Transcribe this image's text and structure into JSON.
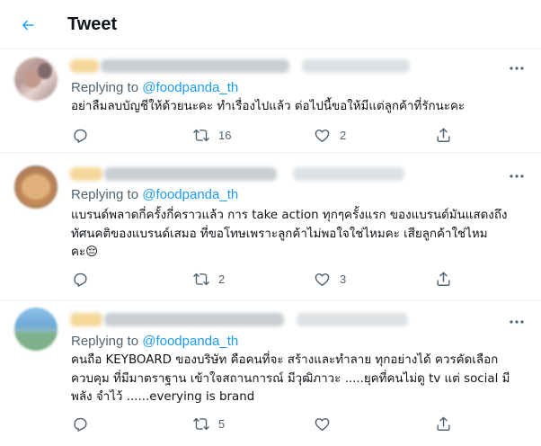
{
  "header": {
    "title": "Tweet",
    "back_icon": "arrow-left-icon",
    "accent_color": "#1d9bf0"
  },
  "tweets": [
    {
      "replying_prefix": "Replying to ",
      "replying_handle": "@foodpanda_th",
      "text": "อย่าลืมลบบัญชีให้ด้วยนะคะ ทำเรื่องไปแล้ว ต่อไปนี้ขอให้มีแต่ลูกค้าที่รักนะคะ",
      "reply_count": "",
      "retweet_count": "16",
      "like_count": "2"
    },
    {
      "replying_prefix": "Replying to ",
      "replying_handle": "@foodpanda_th",
      "text": "แบรนด์พลาดกี่ครั้งกี่คราวแล้ว การ take action ทุกๆครั้งแรก ของแบรนด์มันแสดงถึง\nทัศนคติของแบรนด์เสมอ ที่ขอโทษเพราะลูกค้าไม่พอใจใช่ไหมคะ เสียลูกค้าใช่ไหม\nคะ😔",
      "reply_count": "",
      "retweet_count": "2",
      "like_count": "3"
    },
    {
      "replying_prefix": "Replying to ",
      "replying_handle": "@foodpanda_th",
      "text": "คนถือ KEYBOARD ของบริษัท คือคนที่จะ สร้างและทำลาย ทุกอย่างได้ ควรคัดเลือก\nควบคุม ที่มีมาตราฐาน เข้าใจสถานการณ์ มีวุฒิภาวะ .....ยุคที่คนไม่ดู tv แต่ social มี\nพลัง จำไว้ ......everying is brand",
      "reply_count": "",
      "retweet_count": "5",
      "like_count": ""
    }
  ],
  "icons": [
    "reply-icon",
    "retweet-icon",
    "like-icon",
    "share-icon",
    "more-icon"
  ]
}
